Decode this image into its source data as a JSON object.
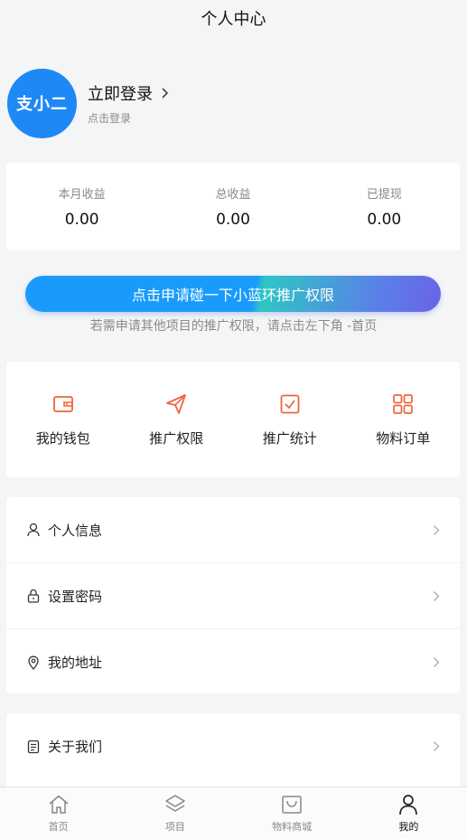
{
  "header": {
    "title": "个人中心"
  },
  "profile": {
    "avatar_text": "支小二",
    "login_label": "立即登录",
    "login_sub": "点击登录"
  },
  "earnings": [
    {
      "label": "本月收益",
      "value": "0.00"
    },
    {
      "label": "总收益",
      "value": "0.00"
    },
    {
      "label": "已提现",
      "value": "0.00"
    }
  ],
  "apply": {
    "button_label": "点击申请碰一下小蓝环推广权限",
    "hint": "若需申请其他项目的推广权限，请点击左下角 -首页"
  },
  "features": [
    {
      "label": "我的钱包",
      "icon": "wallet-icon"
    },
    {
      "label": "推广权限",
      "icon": "paper-plane-icon"
    },
    {
      "label": "推广统计",
      "icon": "checkbox-icon"
    },
    {
      "label": "物料订单",
      "icon": "grid-icon"
    }
  ],
  "menu": [
    {
      "label": "个人信息",
      "icon": "user-icon"
    },
    {
      "label": "设置密码",
      "icon": "lock-icon"
    },
    {
      "label": "我的地址",
      "icon": "location-pin-icon"
    }
  ],
  "menu2": [
    {
      "label": "关于我们",
      "icon": "document-icon"
    }
  ],
  "tabbar": [
    {
      "label": "首页",
      "icon": "home-icon",
      "active": false
    },
    {
      "label": "项目",
      "icon": "layers-icon",
      "active": false
    },
    {
      "label": "物料商城",
      "icon": "shopping-bag-icon",
      "active": false
    },
    {
      "label": "我的",
      "icon": "user-icon",
      "active": true
    }
  ],
  "colors": {
    "accent": "#1e88f5",
    "feature_icon": "#f0643c",
    "background": "#f4f5f7"
  }
}
